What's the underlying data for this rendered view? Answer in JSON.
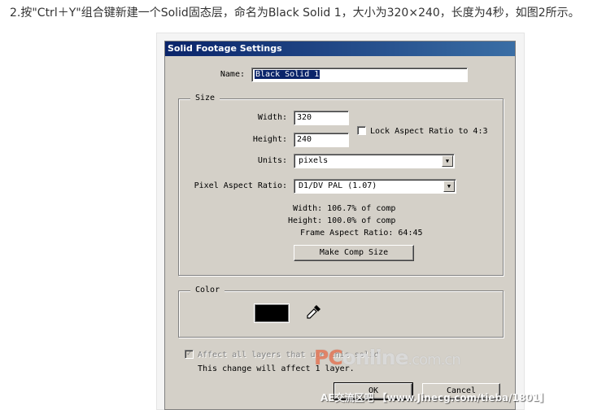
{
  "instruction": "2.按\"Ctrl＋Y\"组合键新建一个Solid固态层，命名为Black Solid 1，大小为320×240，长度为4秒，如图2所示。",
  "dialog": {
    "title": "Solid Footage Settings",
    "name_label": "Name:",
    "name_value": "Black Solid 1",
    "size": {
      "group_label": "Size",
      "width_label": "Width:",
      "width_value": "320",
      "height_label": "Height:",
      "height_value": "240",
      "lock_label": "Lock Aspect Ratio to 4:3",
      "lock_checked": false,
      "units_label": "Units:",
      "units_value": "pixels",
      "par_label": "Pixel Aspect Ratio:",
      "par_value": "D1/DV PAL (1.07)",
      "info_width": "Width: 106.7% of comp",
      "info_height": "Height: 100.0% of comp",
      "info_frame": "Frame Aspect Ratio: 64:45",
      "make_comp_label": "Make Comp Size"
    },
    "color": {
      "group_label": "Color",
      "swatch_color": "#000000",
      "eyedropper_icon": "eyedropper-icon"
    },
    "affect_label": "Affect all layers that use this solid",
    "affect_checked": true,
    "note": "This change will affect 1 layer.",
    "ok_label": "OK",
    "cancel_label": "Cancel"
  },
  "watermark": {
    "brand_pc": "PC",
    "brand_rest": "online",
    "brand_domain": ".com.cn",
    "footer": "AE交流区吧 【www.Jinecg.com/tieba/1801】"
  }
}
